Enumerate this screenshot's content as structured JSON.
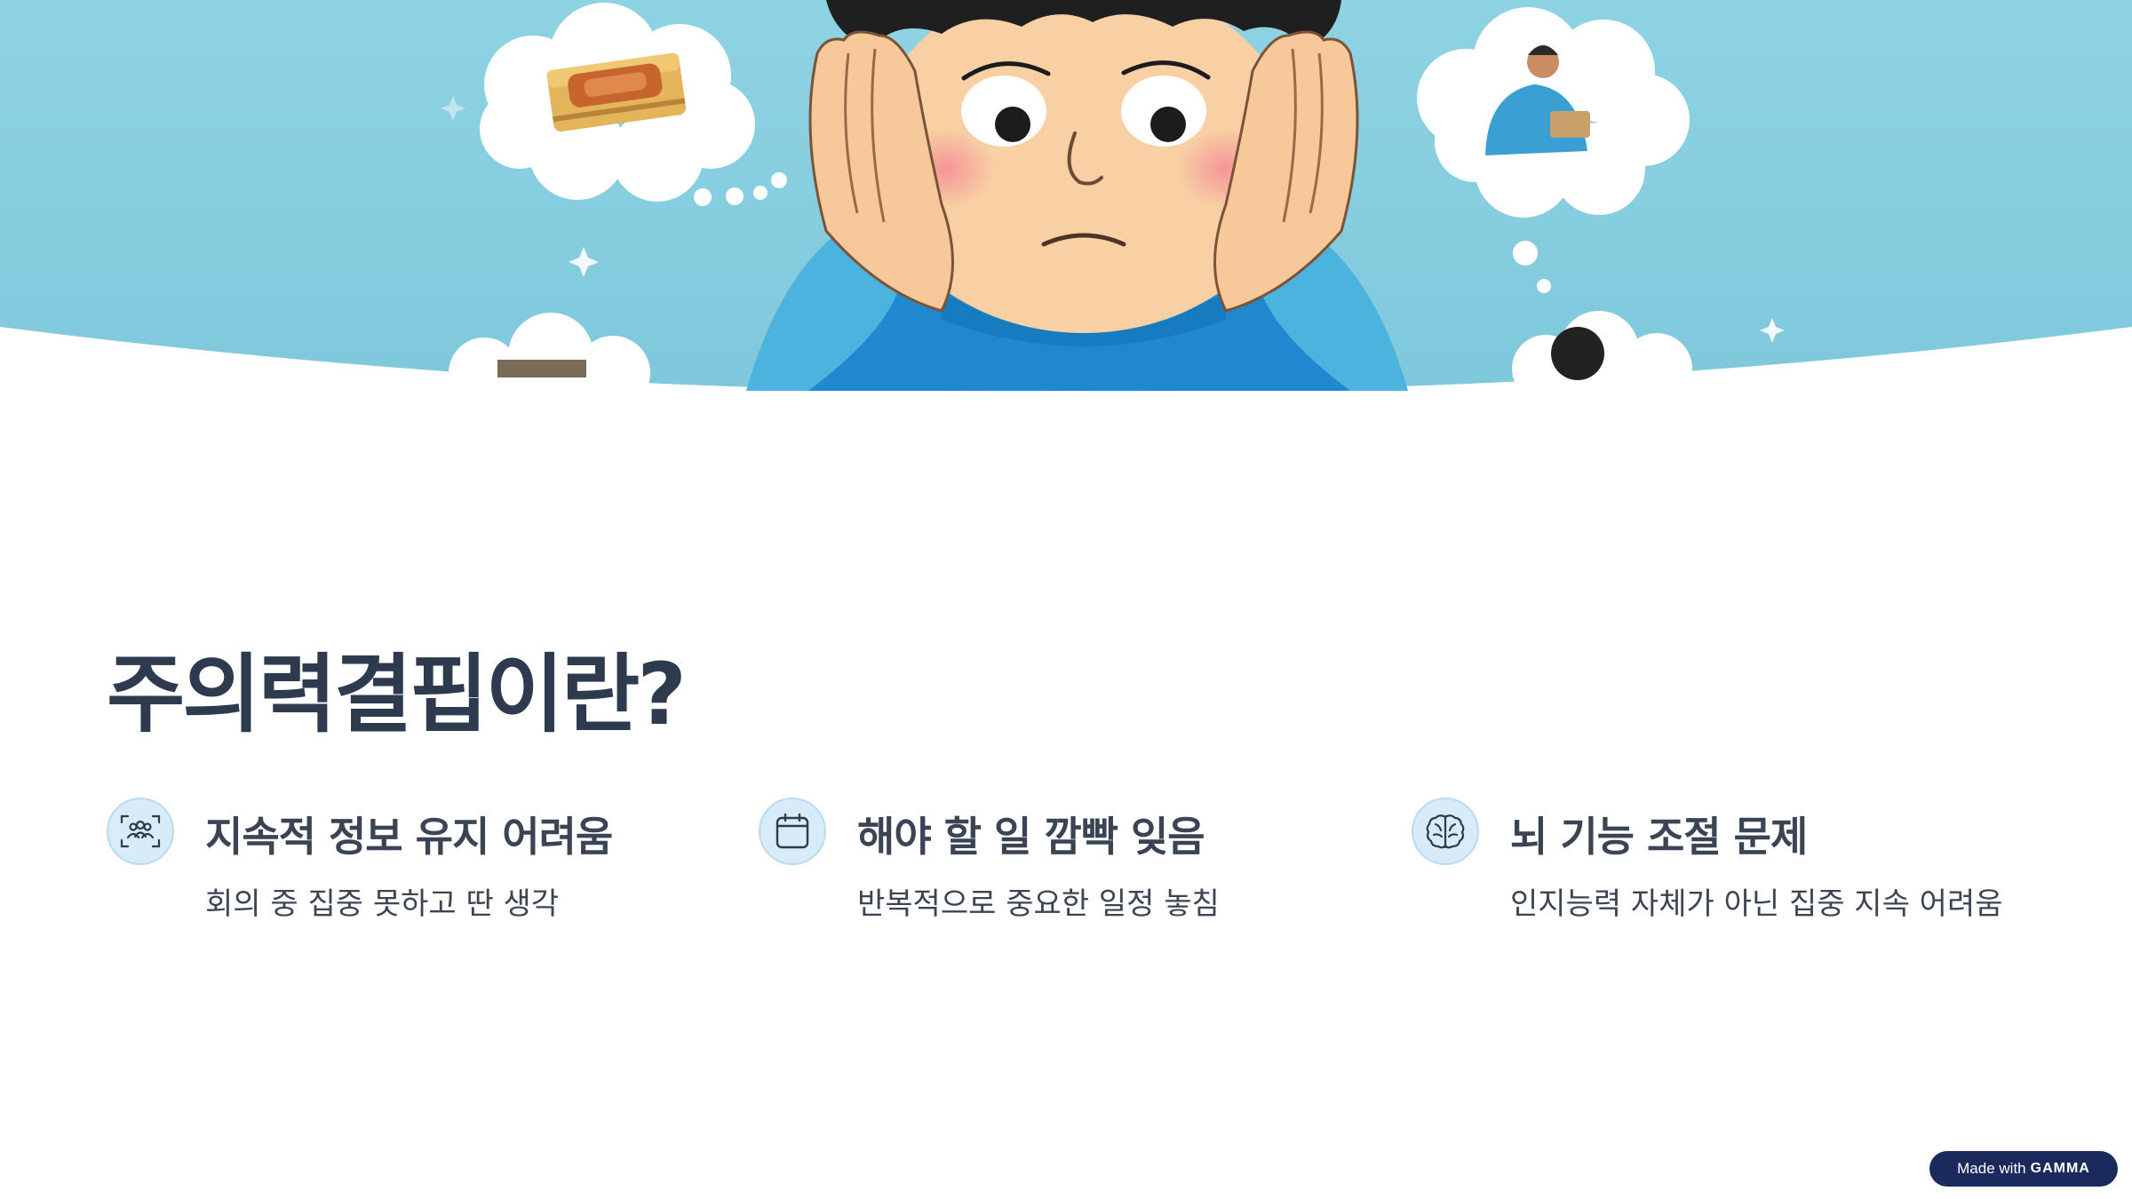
{
  "slide": {
    "title": "주의력결핍이란?",
    "features": [
      {
        "icon": "people-focus-icon",
        "title": "지속적 정보 유지 어려움",
        "description": "회의 중 집중 못하고 딴 생각"
      },
      {
        "icon": "calendar-icon",
        "title": "해야 할 일 깜빡 잊음",
        "description": "반복적으로 중요한 일정 놓침"
      },
      {
        "icon": "brain-icon",
        "title": "뇌 기능 조절 문제",
        "description": "인지능력 자체가 아닌 집중 지속 어려움"
      }
    ]
  },
  "badge": {
    "prefix": "Made with",
    "brand": "GAMMA"
  },
  "colors": {
    "sky": "#8fd3e4",
    "accent": "#d7ebf8",
    "title": "#2e3a4e",
    "badge": "#1a2a5c"
  }
}
